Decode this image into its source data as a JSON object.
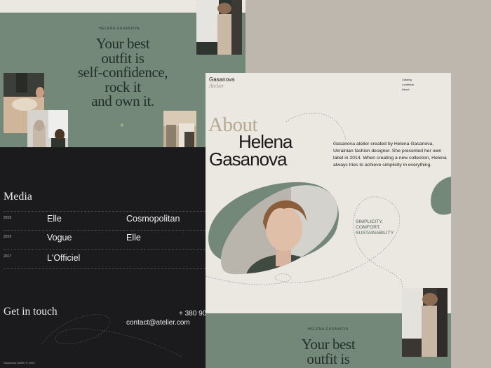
{
  "brand": {
    "name": "Gasanova",
    "sub": "Atelier"
  },
  "nav": {
    "items": [
      "Catalog",
      "Lookbook",
      "About"
    ]
  },
  "hero": {
    "subtitle": "HELENA GASANOVA",
    "title_lines": [
      "Your best",
      "outfit is",
      "self-confidence,",
      "rock it",
      "and own it."
    ]
  },
  "media": {
    "title": "Media",
    "rows": [
      {
        "year": "2019",
        "items": [
          "Elle",
          "Cosmopolitan"
        ]
      },
      {
        "year": "2019",
        "items": [
          "Vogue",
          "Elle"
        ]
      },
      {
        "year": "2017",
        "items": [
          "L'Officiel",
          ""
        ]
      }
    ]
  },
  "contact": {
    "title": "Get in touch",
    "phone": "+ 380 90",
    "email": "contact@atelier.com"
  },
  "footer": {
    "copyright": "Gasanova Atelier © 2020"
  },
  "about": {
    "label": "About",
    "name_lines": [
      "Helena",
      "Gasanova"
    ],
    "paragraph_lines": [
      "Gasanova atelier created by Helena Gasanova,",
      "Ukrainian fashion designer. She presented her own",
      "label in 2014. When creating a new collection, Helena",
      "always tries to achieve simplicity in everything."
    ],
    "values": [
      "SIMPLICITY,",
      "COMFORT,",
      "SUSTAINABILITY"
    ]
  },
  "second_hero": {
    "subtitle": "HELENA GASANOVA",
    "title_lines": [
      "Your best",
      "outfit is"
    ]
  },
  "colors": {
    "sage": "#74887a",
    "dark": "#1b1b1d",
    "cream": "#ebe7e1",
    "taupe": "#beb7ae"
  }
}
